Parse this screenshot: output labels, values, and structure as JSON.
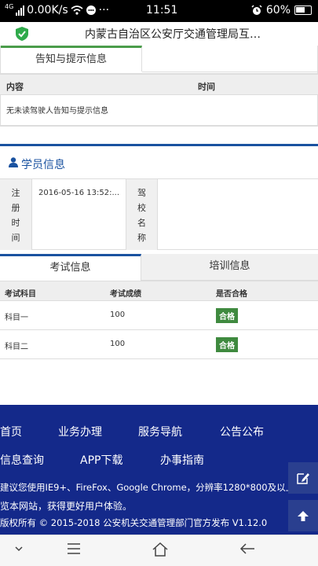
{
  "status_bar": {
    "network": "4G",
    "speed": "0.00K/s",
    "more": "···",
    "time": "11:51",
    "battery": "60%"
  },
  "header": {
    "title": "内蒙古自治区公安厅交通管理局互…",
    "shield_color": "#2faa4b"
  },
  "notice": {
    "tab_label": "告知与提示信息",
    "columns": [
      "内容",
      "时间"
    ],
    "empty_text": "无未读驾驶人告知与提示信息"
  },
  "student": {
    "section_title": "学员信息",
    "register_label": [
      "注",
      "册",
      "时",
      "间"
    ],
    "register_value": "2016-05-16 13:52:...",
    "school_label": [
      "驾",
      "校",
      "名",
      "称"
    ],
    "school_value": ""
  },
  "exam": {
    "tabs": [
      "考试信息",
      "培训信息"
    ],
    "columns": [
      "考试科目",
      "考试成绩",
      "是否合格"
    ],
    "rows": [
      {
        "subject": "科目一",
        "score": "100",
        "result": "合格"
      },
      {
        "subject": "科目二",
        "score": "100",
        "result": "合格"
      }
    ]
  },
  "footer": {
    "nav_row1": [
      "首页",
      "业务办理",
      "服务导航",
      "公告公布"
    ],
    "nav_row2": [
      "信息查询",
      "APP下载",
      "办事指南"
    ],
    "notice_line1": "建议您使用IE9+、FireFox、Google Chrome，分辨率1280*800及以上浏",
    "notice_line2": "览本网站，获得更好用户体验。",
    "copyright": "版权所有 © 2015-2018 公安机关交通管理部门官方发布 V1.12.0",
    "bg_color": "#14298a"
  },
  "colors": {
    "green_accent": "#4a9d4a",
    "blue_accent": "#1a52a0",
    "pass_badge": "#3f8a3f"
  }
}
